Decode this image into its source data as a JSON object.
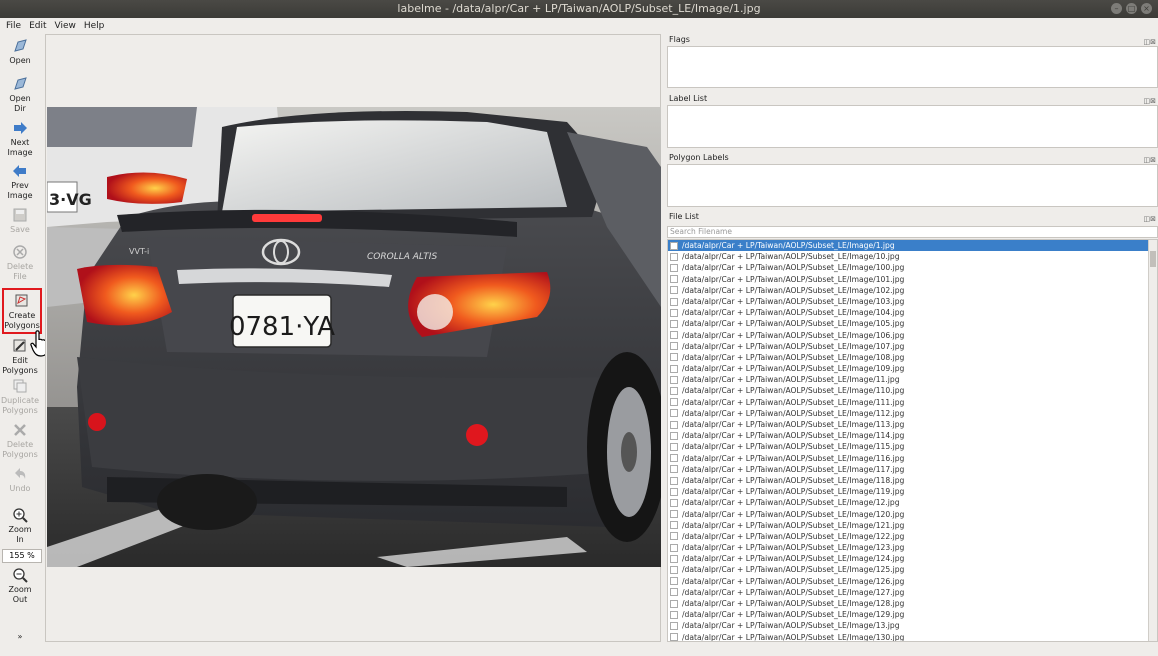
{
  "window": {
    "title": "labelme - /data/alpr/Car + LP/Taiwan/AOLP/Subset_LE/Image/1.jpg",
    "buttons": [
      "–",
      "□",
      "×"
    ]
  },
  "menu": [
    "File",
    "Edit",
    "View",
    "Help"
  ],
  "toolbar": {
    "open": "Open",
    "open_dir_1": "Open",
    "open_dir_2": "Dir",
    "next_1": "Next",
    "next_2": "Image",
    "prev_1": "Prev",
    "prev_2": "Image",
    "save": "Save",
    "delete_1": "Delete",
    "delete_2": "File",
    "create_1": "Create",
    "create_2": "Polygons",
    "edit_1": "Edit",
    "edit_2": "Polygons",
    "dup_1": "Duplicate",
    "dup_2": "Polygons",
    "delpoly_1": "Delete",
    "delpoly_2": "Polygons",
    "undo": "Undo",
    "zoomin_1": "Zoom",
    "zoomin_2": "In",
    "zoom_value": "155 %",
    "zoomout_1": "Zoom",
    "zoomout_2": "Out",
    "more": "»"
  },
  "photo": {
    "plate": "0781·YA",
    "plate_left": "3·VG",
    "badge": "COROLLA ALTIS",
    "engine_badge": "VVT-i"
  },
  "panels": {
    "flags": "Flags",
    "label_list": "Label List",
    "polygon_labels": "Polygon Labels",
    "file_list": "File List",
    "ctrl": "◫⊠",
    "search_placeholder": "Search Filename"
  },
  "files": [
    "/data/alpr/Car + LP/Taiwan/AOLP/Subset_LE/Image/1.jpg",
    "/data/alpr/Car + LP/Taiwan/AOLP/Subset_LE/Image/10.jpg",
    "/data/alpr/Car + LP/Taiwan/AOLP/Subset_LE/Image/100.jpg",
    "/data/alpr/Car + LP/Taiwan/AOLP/Subset_LE/Image/101.jpg",
    "/data/alpr/Car + LP/Taiwan/AOLP/Subset_LE/Image/102.jpg",
    "/data/alpr/Car + LP/Taiwan/AOLP/Subset_LE/Image/103.jpg",
    "/data/alpr/Car + LP/Taiwan/AOLP/Subset_LE/Image/104.jpg",
    "/data/alpr/Car + LP/Taiwan/AOLP/Subset_LE/Image/105.jpg",
    "/data/alpr/Car + LP/Taiwan/AOLP/Subset_LE/Image/106.jpg",
    "/data/alpr/Car + LP/Taiwan/AOLP/Subset_LE/Image/107.jpg",
    "/data/alpr/Car + LP/Taiwan/AOLP/Subset_LE/Image/108.jpg",
    "/data/alpr/Car + LP/Taiwan/AOLP/Subset_LE/Image/109.jpg",
    "/data/alpr/Car + LP/Taiwan/AOLP/Subset_LE/Image/11.jpg",
    "/data/alpr/Car + LP/Taiwan/AOLP/Subset_LE/Image/110.jpg",
    "/data/alpr/Car + LP/Taiwan/AOLP/Subset_LE/Image/111.jpg",
    "/data/alpr/Car + LP/Taiwan/AOLP/Subset_LE/Image/112.jpg",
    "/data/alpr/Car + LP/Taiwan/AOLP/Subset_LE/Image/113.jpg",
    "/data/alpr/Car + LP/Taiwan/AOLP/Subset_LE/Image/114.jpg",
    "/data/alpr/Car + LP/Taiwan/AOLP/Subset_LE/Image/115.jpg",
    "/data/alpr/Car + LP/Taiwan/AOLP/Subset_LE/Image/116.jpg",
    "/data/alpr/Car + LP/Taiwan/AOLP/Subset_LE/Image/117.jpg",
    "/data/alpr/Car + LP/Taiwan/AOLP/Subset_LE/Image/118.jpg",
    "/data/alpr/Car + LP/Taiwan/AOLP/Subset_LE/Image/119.jpg",
    "/data/alpr/Car + LP/Taiwan/AOLP/Subset_LE/Image/12.jpg",
    "/data/alpr/Car + LP/Taiwan/AOLP/Subset_LE/Image/120.jpg",
    "/data/alpr/Car + LP/Taiwan/AOLP/Subset_LE/Image/121.jpg",
    "/data/alpr/Car + LP/Taiwan/AOLP/Subset_LE/Image/122.jpg",
    "/data/alpr/Car + LP/Taiwan/AOLP/Subset_LE/Image/123.jpg",
    "/data/alpr/Car + LP/Taiwan/AOLP/Subset_LE/Image/124.jpg",
    "/data/alpr/Car + LP/Taiwan/AOLP/Subset_LE/Image/125.jpg",
    "/data/alpr/Car + LP/Taiwan/AOLP/Subset_LE/Image/126.jpg",
    "/data/alpr/Car + LP/Taiwan/AOLP/Subset_LE/Image/127.jpg",
    "/data/alpr/Car + LP/Taiwan/AOLP/Subset_LE/Image/128.jpg",
    "/data/alpr/Car + LP/Taiwan/AOLP/Subset_LE/Image/129.jpg",
    "/data/alpr/Car + LP/Taiwan/AOLP/Subset_LE/Image/13.jpg",
    "/data/alpr/Car + LP/Taiwan/AOLP/Subset_LE/Image/130.jpg"
  ],
  "colors": {
    "selection": "#3a7fc9",
    "highlight": "#e0191e",
    "toolbar_icon": "#4a7fc0"
  }
}
